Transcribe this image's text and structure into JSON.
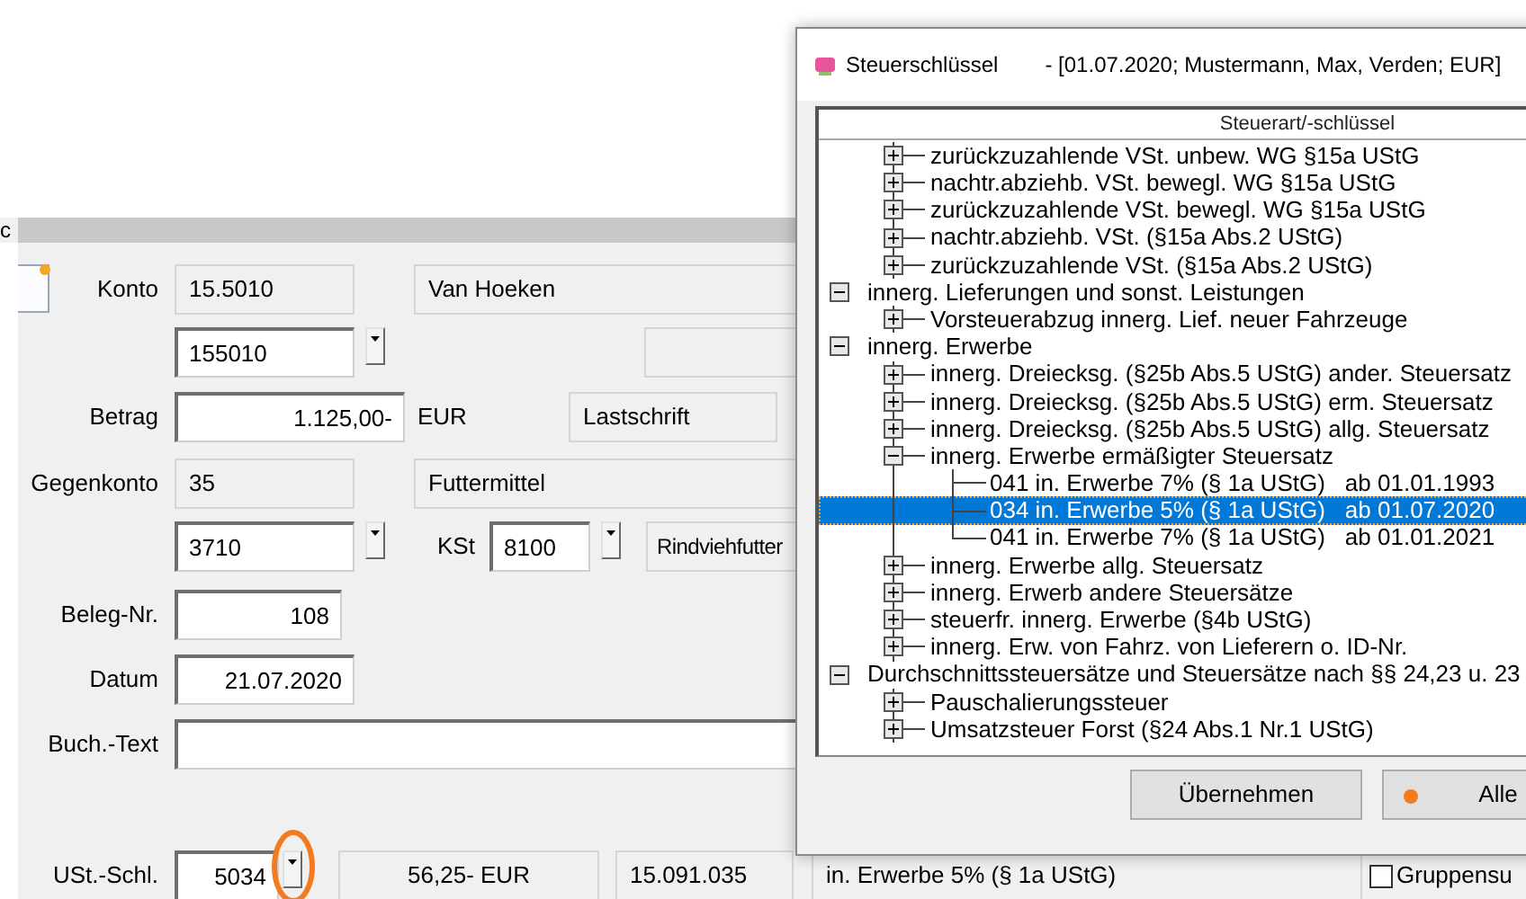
{
  "section_tab": {
    "label": "c"
  },
  "form": {
    "konto": {
      "label": "Konto",
      "number": "15.5010",
      "name": "Van Hoeken",
      "input": "155010"
    },
    "betrag": {
      "label": "Betrag",
      "value": "1.125,00-",
      "currency": "EUR",
      "type": "Lastschrift"
    },
    "gegenkonto": {
      "label": "Gegenkonto",
      "number": "35",
      "name": "Futtermittel",
      "input": "3710"
    },
    "kst": {
      "label": "KSt",
      "value": "8100",
      "name": "Rindviehfutter"
    },
    "beleg_nr": {
      "label": "Beleg-Nr.",
      "value": "108"
    },
    "datum": {
      "label": "Datum",
      "value": "21.07.2020"
    },
    "buch_text": {
      "label": "Buch.-Text"
    },
    "ust": {
      "label": "USt.-Schl.",
      "value": "5034",
      "highlighted": true,
      "amount": "56,25- EUR",
      "account": "15.091.035",
      "description": "in. Erwerbe 5% (§ 1a UStG)"
    },
    "group_sum": {
      "label": "Gruppensu",
      "checked": false
    }
  },
  "dialog": {
    "title": "Steuerschlüssel",
    "subtitle": "- [01.07.2020; Mustermann, Max, Verden; EUR]",
    "column": "Steuerart/-schlüssel",
    "tree": [
      {
        "children": [
          {
            "label": "zurückzuzahlende VSt. unbew. WG §15a UStG",
            "expanded": false,
            "selected": false
          },
          {
            "label": "nachtr.abziehb. VSt. bewegl. WG §15a UStG",
            "expanded": false,
            "selected": false
          },
          {
            "label": "zurückzuzahlende VSt. bewegl. WG §15a UStG",
            "expanded": false,
            "selected": false
          },
          {
            "label": "nachtr.abziehb. VSt. (§15a Abs.2 UStG)",
            "expanded": false,
            "selected": false
          },
          {
            "label": "zurückzuzahlende VSt. (§15a Abs.2 UStG)",
            "expanded": false,
            "selected": false
          }
        ]
      },
      {
        "label": "innerg. Lieferungen und sonst. Leistungen",
        "expanded": true,
        "selected": false,
        "children": [
          {
            "label": "Vorsteuerabzug innerg. Lief. neuer Fahrzeuge",
            "expanded": false,
            "selected": false
          }
        ]
      },
      {
        "label": "innerg. Erwerbe",
        "expanded": true,
        "selected": false,
        "children": [
          {
            "label": "innerg. Dreiecksg. (§25b Abs.5 UStG) ander. Steuersatz",
            "expanded": false,
            "selected": false
          },
          {
            "label": "innerg. Dreiecksg. (§25b Abs.5 UStG) erm. Steuersatz",
            "expanded": false,
            "selected": false
          },
          {
            "label": "innerg. Dreiecksg. (§25b Abs.5 UStG) allg. Steuersatz",
            "expanded": false,
            "selected": false
          },
          {
            "label": "innerg. Erwerbe ermäßigter Steuersatz",
            "expanded": true,
            "selected": false,
            "children": [
              {
                "label": "041 in. Erwerbe 7% (§ 1a UStG)",
                "valid_from": "ab 01.01.1993",
                "selected": false
              },
              {
                "label": "034 in. Erwerbe 5% (§ 1a UStG)",
                "valid_from": "ab 01.07.2020",
                "selected": true
              },
              {
                "label": "041 in. Erwerbe 7% (§ 1a UStG)",
                "valid_from": "ab 01.01.2021",
                "selected": false
              }
            ]
          },
          {
            "label": "innerg. Erwerbe allg. Steuersatz",
            "expanded": false,
            "selected": false
          },
          {
            "label": "innerg. Erwerb andere Steuersätze",
            "expanded": false,
            "selected": false
          },
          {
            "label": "steuerfr. innerg. Erwerbe (§4b UStG)",
            "expanded": false,
            "selected": false
          },
          {
            "label": "innerg. Erw. von Fahrz. von Lieferern o. ID-Nr.",
            "expanded": false,
            "selected": false
          }
        ]
      },
      {
        "label": "Durchschnittssteuersätze und Steuersätze nach §§ 24,23 u. 23",
        "expanded": true,
        "selected": false,
        "children": [
          {
            "label": "Pauschalierungssteuer",
            "expanded": false,
            "selected": false
          },
          {
            "label": "Umsatzsteuer Forst (§24 Abs.1 Nr.1 UStG)",
            "expanded": false,
            "selected": false
          }
        ]
      }
    ],
    "buttons": [
      {
        "label": "Übernehmen",
        "kind": "plain"
      },
      {
        "label": "Alle",
        "kind": "dot"
      }
    ]
  }
}
